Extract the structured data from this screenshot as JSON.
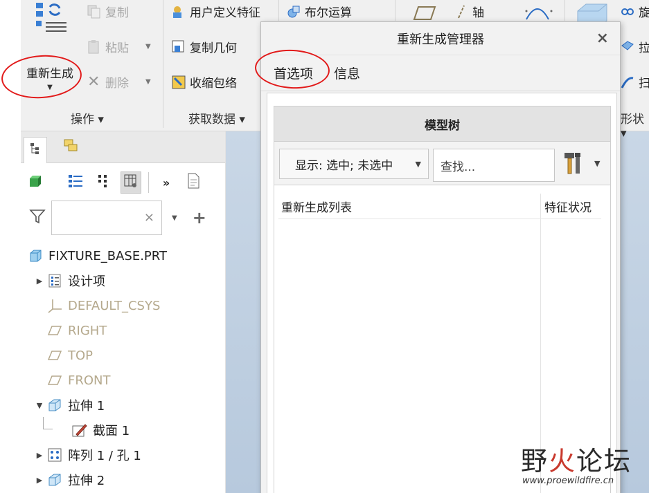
{
  "ribbon": {
    "operations": {
      "regenerate_label": "重新生成",
      "copy_label": "复制",
      "paste_label": "粘贴",
      "delete_label": "删除",
      "group_label": "操作 ▾"
    },
    "get_data": {
      "udf_label": "用户定义特征",
      "copy_geom_label": "复制几何",
      "shrinkwrap_label": "收缩包络",
      "group_label": "获取数据 ▾"
    },
    "bool_label": "布尔运算",
    "axis_label": "轴",
    "shape_group_label": "形状 ▾",
    "right_partial_labels": [
      "旋",
      "拉",
      "扫"
    ]
  },
  "left_panel": {
    "filter": {
      "value": "",
      "clear_symbol": "×",
      "add_symbol": "+"
    },
    "tree": [
      {
        "label": "FIXTURE_BASE.PRT",
        "icon": "part-icon",
        "expand": "",
        "indent": 0,
        "muted": false
      },
      {
        "label": "设计项",
        "icon": "design-items-icon",
        "expand": "▶",
        "indent": 1,
        "muted": false
      },
      {
        "label": "DEFAULT_CSYS",
        "icon": "csys-icon",
        "expand": "",
        "indent": 1,
        "muted": true
      },
      {
        "label": "RIGHT",
        "icon": "datum-plane-icon",
        "expand": "",
        "indent": 1,
        "muted": true
      },
      {
        "label": "TOP",
        "icon": "datum-plane-icon",
        "expand": "",
        "indent": 1,
        "muted": true
      },
      {
        "label": "FRONT",
        "icon": "datum-plane-icon",
        "expand": "",
        "indent": 1,
        "muted": true
      },
      {
        "label": "拉伸 1",
        "icon": "extrude-icon",
        "expand": "▼",
        "indent": 1,
        "muted": false
      },
      {
        "label": "截面 1",
        "icon": "sketch-icon",
        "expand": "",
        "indent": 2,
        "muted": false
      },
      {
        "label": "阵列 1 / 孔 1",
        "icon": "pattern-icon",
        "expand": "▶",
        "indent": 1,
        "muted": false
      },
      {
        "label": "拉伸 2",
        "icon": "extrude-icon",
        "expand": "▶",
        "indent": 1,
        "muted": false
      }
    ]
  },
  "dialog": {
    "title": "重新生成管理器",
    "close_symbol": "×",
    "tabs": [
      {
        "label": "首选项",
        "active": true
      },
      {
        "label": "信息",
        "active": false
      }
    ],
    "model_tree_header": "模型树",
    "display_select_value": "显示: 选中; 未选中",
    "find_placeholder": "查找...",
    "columns": [
      "重新生成列表",
      "特征状况"
    ]
  },
  "watermark": {
    "title_part1": "野",
    "title_part2": "火",
    "title_part3": "论坛",
    "url": "www.proewildfire.cn"
  },
  "colors": {
    "annotation_red": "#e21a1a",
    "muted_text": "#b5a98d",
    "ribbon_bg": "#f0f0f0",
    "dialog_bg": "#f2f2f2"
  }
}
